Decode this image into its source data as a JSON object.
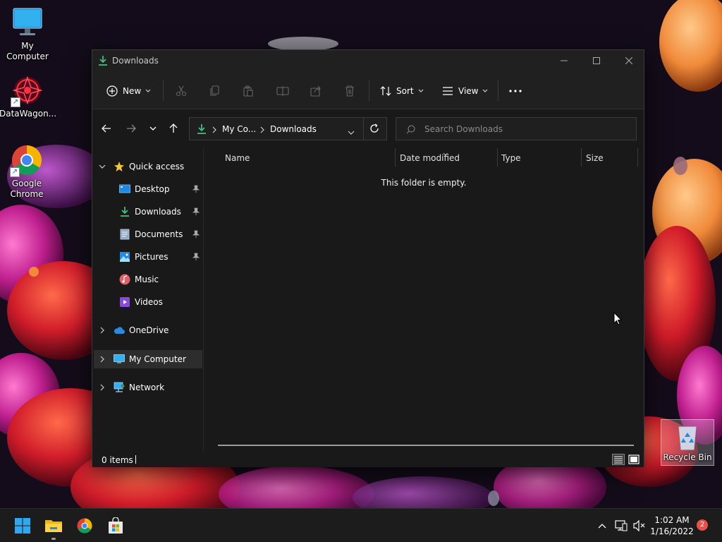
{
  "desktop": {
    "icons": [
      {
        "label": "My Computer"
      },
      {
        "label": "DataWagon..."
      },
      {
        "label": "Google Chrome"
      },
      {
        "label": "Recycle Bin"
      }
    ]
  },
  "window": {
    "title": "Downloads",
    "title_icon": "download-icon"
  },
  "commandbar": {
    "new_label": "New",
    "sort_label": "Sort",
    "view_label": "View",
    "icons": [
      "add-icon",
      "cut-icon",
      "copy-icon",
      "paste-icon",
      "rename-icon",
      "share-icon",
      "delete-icon",
      "sort-icon",
      "view-icon",
      "more-icon"
    ]
  },
  "address": {
    "crumbs": [
      "My Co...",
      "Downloads"
    ]
  },
  "search": {
    "placeholder": "Search Downloads"
  },
  "navpane": {
    "quick_access": "Quick access",
    "items": [
      {
        "label": "Desktop",
        "icon": "desktop-icon",
        "pinned": true
      },
      {
        "label": "Downloads",
        "icon": "download-icon",
        "pinned": true
      },
      {
        "label": "Documents",
        "icon": "documents-icon",
        "pinned": true
      },
      {
        "label": "Pictures",
        "icon": "pictures-icon",
        "pinned": true
      },
      {
        "label": "Music",
        "icon": "music-icon",
        "pinned": false
      },
      {
        "label": "Videos",
        "icon": "videos-icon",
        "pinned": false
      }
    ],
    "onedrive": "OneDrive",
    "my_computer": "My Computer",
    "network": "Network"
  },
  "content": {
    "columns": [
      "Name",
      "Date modified",
      "Type",
      "Size"
    ],
    "empty_message": "This folder is empty."
  },
  "status": {
    "item_count": "0 items"
  },
  "taskbar": {
    "time": "1:02 AM",
    "date": "1/16/2022",
    "notification_count": "2",
    "apps": [
      "windows-start-icon",
      "file-explorer-icon",
      "chrome-icon",
      "store-icon"
    ]
  },
  "colors": {
    "accent_download": "#3fbf7f",
    "folder_yellow": "#f4c542",
    "selected_bg": "#2d2d2d",
    "badge_red": "#e8514a"
  }
}
